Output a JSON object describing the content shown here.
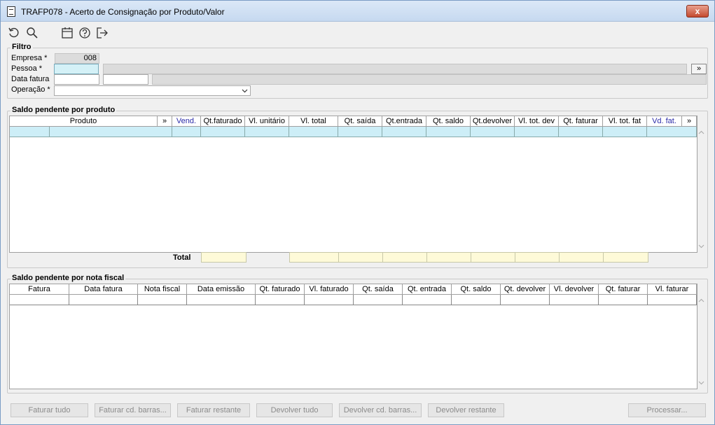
{
  "window": {
    "title": "TRAFP078 - Acerto de Consignação por Produto/Valor",
    "close_label": "x"
  },
  "toolbar": {
    "icons": [
      "refresh-icon",
      "search-icon",
      "calendar-icon",
      "help-icon",
      "exit-icon"
    ]
  },
  "filtro": {
    "legend": "Filtro",
    "empresa_label": "Empresa *",
    "empresa_value": "008",
    "pessoa_label": "Pessoa *",
    "pessoa_more": "»",
    "data_fatura_label": "Data fatura",
    "operacao_label": "Operação *"
  },
  "produto": {
    "legend": "Saldo pendente por produto",
    "columns": [
      "Produto",
      "»",
      "Vend.",
      "Qt.faturado",
      "Vl. unitário",
      "Vl. total",
      "Qt. saída",
      "Qt.entrada",
      "Qt. saldo",
      "Qt.devolver",
      "Vl. tot. dev",
      "Qt. faturar",
      "Vl. tot. fat",
      "Vd. fat.",
      "»"
    ],
    "total_label": "Total"
  },
  "notafiscal": {
    "legend": "Saldo pendente por nota fiscal",
    "columns": [
      "Fatura",
      "Data fatura",
      "Nota fiscal",
      "Data emissão",
      "Qt. faturado",
      "Vl. faturado",
      "Qt. saída",
      "Qt. entrada",
      "Qt. saldo",
      "Qt. devolver",
      "Vl. devolver",
      "Qt. faturar",
      "Vl. faturar"
    ]
  },
  "buttons": {
    "faturar_tudo": "Faturar tudo",
    "faturar_cd_barras": "Faturar cd. barras...",
    "faturar_restante": "Faturar restante",
    "devolver_tudo": "Devolver tudo",
    "devolver_cd_barras": "Devolver cd. barras...",
    "devolver_restante": "Devolver restante",
    "processar": "Processar..."
  }
}
